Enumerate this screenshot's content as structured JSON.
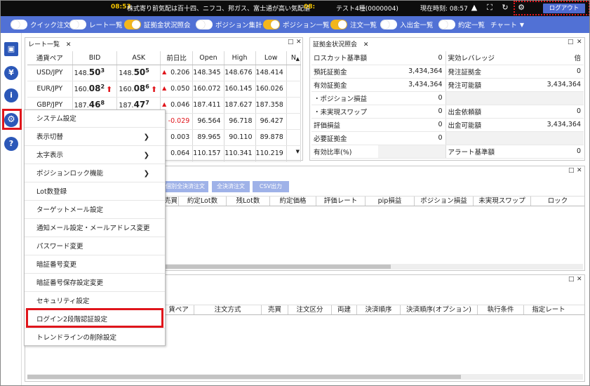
{
  "topbar": {
    "time1": "08:53",
    "news": "株式寄り前気配は百十四、ニフコ、邦ガス、富士通が高い気配値",
    "time2": "08:",
    "account": "テスト4種(0000004)",
    "clock": "現在時刻: 08:57",
    "logout_label": "ログアウト"
  },
  "toolbar": {
    "toggles": [
      "クイック注文",
      "レート一覧",
      "証拠金状況照会",
      "ポジション集計",
      "ポジション一覧",
      "注文一覧",
      "入出金一覧",
      "約定一覧"
    ],
    "chart_label": "チャート"
  },
  "rate_panel": {
    "tab": "レート一覧",
    "headers": [
      "通貨ペア",
      "BID",
      "ASK",
      "前日比",
      "Open",
      "High",
      "Low",
      "N"
    ],
    "rows": [
      {
        "pair": "USD/JPY",
        "bid_a": "148.",
        "bid_b": "50",
        "bid_c": "3",
        "ask_a": "148.",
        "ask_b": "50",
        "ask_c": "5",
        "change": "0.206",
        "open": "148.345",
        "high": "148.676",
        "low": "148.414"
      },
      {
        "pair": "EUR/JPY",
        "bid_a": "160.",
        "bid_b": "08",
        "bid_c": "2",
        "ask_a": "160.",
        "ask_b": "08",
        "ask_c": "6",
        "change": "0.050",
        "open": "160.072",
        "high": "160.145",
        "low": "160.026"
      },
      {
        "pair": "GBP/JPY",
        "bid_a": "187.",
        "bid_b": "46",
        "bid_c": "8",
        "ask_a": "187.",
        "ask_b": "47",
        "ask_c": "7",
        "change": "0.046",
        "open": "187.411",
        "high": "187.627",
        "low": "187.358"
      },
      {
        "pair": "",
        "change": "-0.029",
        "open": "96.564",
        "high": "96.718",
        "low": "96.427"
      },
      {
        "pair": "",
        "change": "0.003",
        "open": "89.965",
        "high": "90.110",
        "low": "89.878"
      },
      {
        "pair": "",
        "change": "0.064",
        "open": "110.157",
        "high": "110.341",
        "low": "110.219"
      }
    ]
  },
  "margin_panel": {
    "tab": "証拠金状況照会",
    "rows": [
      {
        "l1": "ロスカット基準額",
        "v1": "0",
        "l2": "実効レバレッジ",
        "v2": "倍"
      },
      {
        "l1": "預託証拠金",
        "v1": "3,434,364",
        "l2": "発注証拠金",
        "v2": "0"
      },
      {
        "l1": "有効証拠金",
        "v1": "3,434,364",
        "l2": "発注可能額",
        "v2": "3,434,364"
      },
      {
        "l1": "・ポジション損益",
        "v1": "0",
        "l2": "",
        "v2": ""
      },
      {
        "l1": "・未実現スワップ",
        "v1": "0",
        "l2": "出金依頼額",
        "v2": "0"
      },
      {
        "l1": "評価損益",
        "v1": "0",
        "l2": "出金可能額",
        "v2": "3,434,364"
      },
      {
        "l1": "必要証拠金",
        "v1": "0",
        "l2": "",
        "v2": ""
      },
      {
        "l1": "有効比率(%)",
        "v1": "",
        "l2": "アラート基準額",
        "v2": "0"
      }
    ]
  },
  "position_panel": {
    "buttons": [
      "個別全決済注文",
      "全決済注文",
      "CSV出力"
    ],
    "headers": [
      "売買",
      "約定Lot数",
      "残Lot数",
      "約定価格",
      "評価レート",
      "pip損益",
      "ポジション損益",
      "未実現スワップ",
      "ロック"
    ]
  },
  "order_panel": {
    "headers": [
      "貨ペア",
      "注文方式",
      "売買",
      "注文区分",
      "両建",
      "決済順序",
      "決済順序(オプション)",
      "執行条件",
      "指定レート"
    ]
  },
  "settings_menu": {
    "items": [
      {
        "label": "システム設定",
        "sub": false
      },
      {
        "label": "表示切替",
        "sub": true
      },
      {
        "label": "太字表示",
        "sub": true
      },
      {
        "label": "ポジションロック機能",
        "sub": true
      },
      {
        "label": "Lot数登録",
        "sub": false
      },
      {
        "label": "ターゲットメール設定",
        "sub": false
      },
      {
        "label": "通知メール設定・メールアドレス変更",
        "sub": false
      },
      {
        "label": "パスワード変更",
        "sub": false
      },
      {
        "label": "暗証番号変更",
        "sub": false
      },
      {
        "label": "暗証番号保存設定変更",
        "sub": false
      },
      {
        "label": "セキュリティ設定",
        "sub": false
      },
      {
        "label": "ログイン2段階認証設定",
        "sub": false
      },
      {
        "label": "トレンドラインの削除設定",
        "sub": false
      }
    ]
  },
  "icons": {
    "sidebar": [
      "save-icon",
      "deposit-yen-icon",
      "info-icon",
      "gear-icon",
      "help-icon"
    ],
    "accent_red": "#e0151b",
    "toolbar_blue": "#5171d5",
    "switch_on": "#f3b61c"
  }
}
